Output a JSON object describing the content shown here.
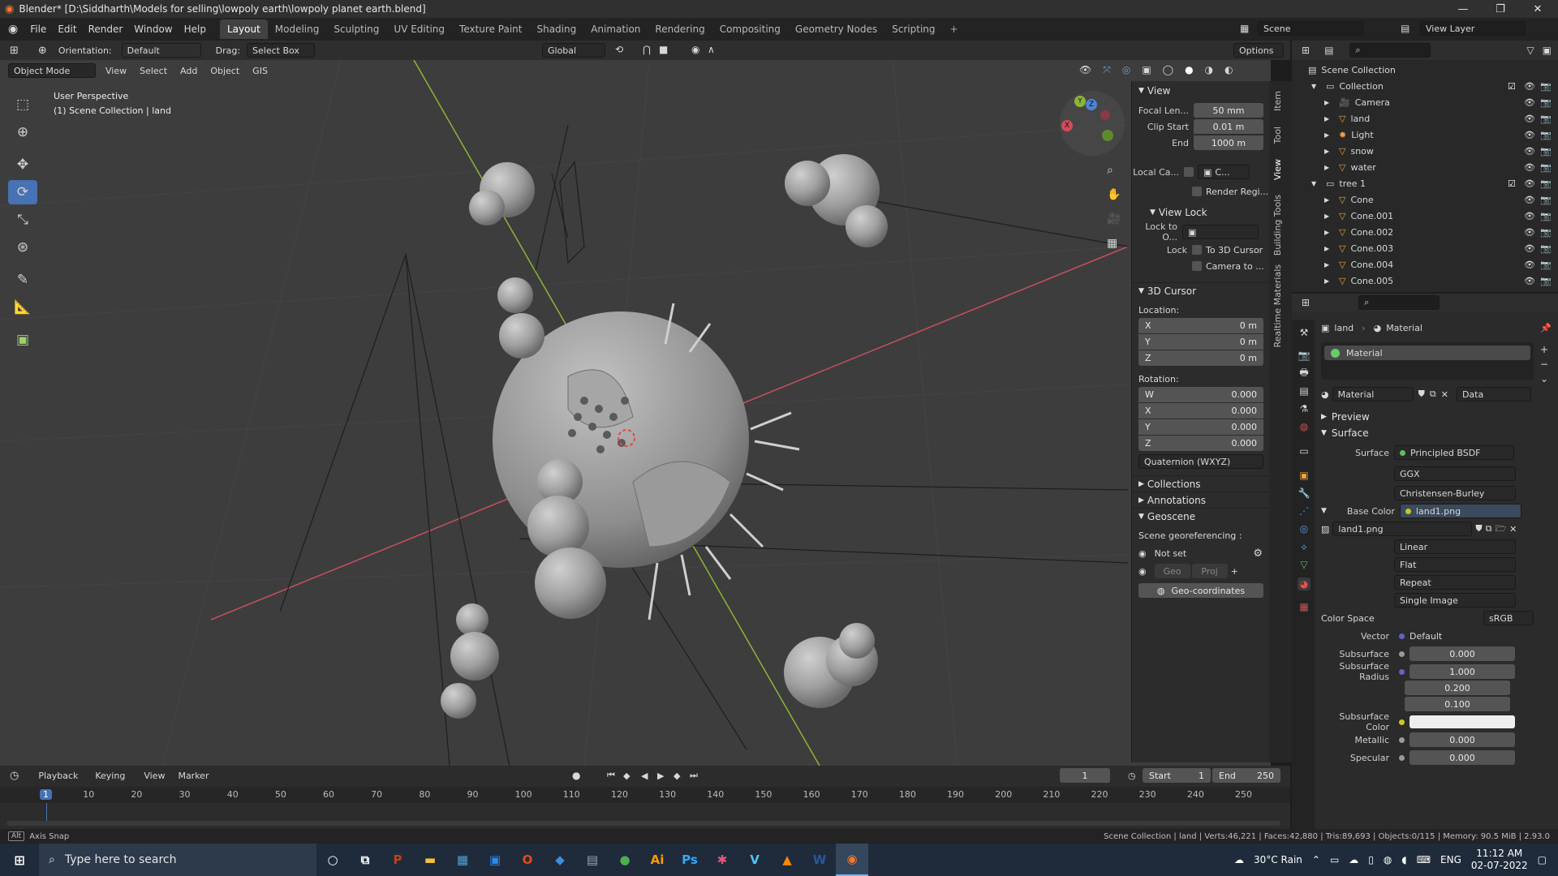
{
  "window": {
    "title": "Blender* [D:\\Siddharth\\Models for selling\\lowpoly earth\\lowpoly planet earth.blend]",
    "controls": [
      "—",
      "❐",
      "✕"
    ]
  },
  "menu": [
    "File",
    "Edit",
    "Render",
    "Window",
    "Help"
  ],
  "workspaces": [
    "Layout",
    "Modeling",
    "Sculpting",
    "UV Editing",
    "Texture Paint",
    "Shading",
    "Animation",
    "Rendering",
    "Compositing",
    "Geometry Nodes",
    "Scripting"
  ],
  "scene": {
    "scene_name": "Scene",
    "view_layer": "View Layer"
  },
  "header": {
    "orientation_label": "Orientation:",
    "orientation": "Default",
    "drag_label": "Drag:",
    "drag": "Select Box",
    "transform": "Global",
    "options": "Options"
  },
  "viewport_menu": {
    "mode": "Object Mode",
    "items": [
      "View",
      "Select",
      "Add",
      "Object",
      "GIS"
    ]
  },
  "viewport": {
    "perspective": "User Perspective",
    "collection": "(1) Scene Collection | land"
  },
  "gizmo": {
    "x": "X",
    "y": "Y",
    "z": "Z"
  },
  "npanel": {
    "view_title": "View",
    "focal_label": "Focal Len...",
    "focal": "50 mm",
    "clip_start_label": "Clip Start",
    "clip_start": "0.01 m",
    "end_label": "End",
    "end": "1000 m",
    "local_cam_label": "Local Ca...",
    "local_cam_value": "C...",
    "render_region": "Render Regi...",
    "view_lock_title": "View Lock",
    "lock_to_label": "Lock to O...",
    "lock_label": "Lock",
    "to_3d_cursor": "To 3D Cursor",
    "camera_to": "Camera to ...",
    "cursor_title": "3D Cursor",
    "location_label": "Location:",
    "loc_x_label": "X",
    "loc_x": "0 m",
    "loc_y_label": "Y",
    "loc_y": "0 m",
    "loc_z_label": "Z",
    "loc_z": "0 m",
    "rotation_label": "Rotation:",
    "rot_w_label": "W",
    "rot_w": "0.000",
    "rot_x_label": "X",
    "rot_x": "0.000",
    "rot_y_label": "Y",
    "rot_y": "0.000",
    "rot_z_label": "Z",
    "rot_z": "0.000",
    "rotation_mode": "Quaternion (WXYZ)",
    "collections": "Collections",
    "annotations": "Annotations",
    "geoscene": "Geoscene",
    "georef_label": "Scene georeferencing :",
    "not_set": "Not set",
    "geo_btn": "Geo",
    "proj_btn": "Proj",
    "geocoords": "Geo-coordinates"
  },
  "side_tabs": [
    "Item",
    "Tool",
    "View",
    "Building Tools",
    "Realtime Materials"
  ],
  "outliner": {
    "root": "Scene Collection",
    "rows": [
      {
        "name": "Collection",
        "level": 1
      },
      {
        "name": "Camera",
        "level": 2
      },
      {
        "name": "land",
        "level": 2
      },
      {
        "name": "Light",
        "level": 2
      },
      {
        "name": "snow",
        "level": 2
      },
      {
        "name": "water",
        "level": 2
      },
      {
        "name": "tree 1",
        "level": 1
      },
      {
        "name": "Cone",
        "level": 2
      },
      {
        "name": "Cone.001",
        "level": 2
      },
      {
        "name": "Cone.002",
        "level": 2
      },
      {
        "name": "Cone.003",
        "level": 2
      },
      {
        "name": "Cone.004",
        "level": 2
      },
      {
        "name": "Cone.005",
        "level": 2
      }
    ]
  },
  "properties": {
    "breadcrumb_object": "land",
    "breadcrumb_material": "Material",
    "slot": "Material",
    "material_name": "Material",
    "link": "Data",
    "preview": "Preview",
    "surface_section": "Surface",
    "surface_label": "Surface",
    "surface_value": "Principled BSDF",
    "distribution": "GGX",
    "subsurface_method": "Christensen-Burley",
    "base_color_label": "Base Color",
    "base_color_value": "land1.png",
    "image_name": "land1.png",
    "interpolation": "Linear",
    "projection": "Flat",
    "extension": "Repeat",
    "source": "Single Image",
    "color_space_label": "Color Space",
    "color_space": "sRGB",
    "vector_label": "Vector",
    "vector": "Default",
    "subsurface_label": "Subsurface",
    "subsurface": "0.000",
    "subsurface_radius_label": "Subsurface Radius",
    "radius": [
      "1.000",
      "0.200",
      "0.100"
    ],
    "subsurface_color_label": "Subsurface Color",
    "metallic_label": "Metallic",
    "metallic": "0.000",
    "specular_label": "Specular",
    "specular": "0.000"
  },
  "timeline": {
    "menus": [
      "Playback",
      "Keying",
      "View",
      "Marker"
    ],
    "current_frame": "1",
    "start_label": "Start",
    "start": "1",
    "end_label": "End",
    "end": "250",
    "ticks": [
      "1",
      "10",
      "20",
      "30",
      "40",
      "50",
      "60",
      "70",
      "80",
      "90",
      "100",
      "110",
      "120",
      "130",
      "140",
      "150",
      "160",
      "170",
      "180",
      "190",
      "200",
      "210",
      "220",
      "230",
      "240",
      "250"
    ]
  },
  "status": {
    "left": "Axis Snap",
    "right": "Scene Collection | land | Verts:46,221 | Faces:42,880 | Tris:89,693 | Objects:0/115 | Memory: 90.5 MiB | 2.93.0"
  },
  "taskbar": {
    "search_placeholder": "Type here to search",
    "apps": [
      {
        "name": "powerpoint",
        "glyph": "P",
        "color": "#c43e1c"
      },
      {
        "name": "file-explorer",
        "glyph": "▬",
        "color": "#f3c13a"
      },
      {
        "name": "photos",
        "glyph": "▦",
        "color": "#4aa3df"
      },
      {
        "name": "store",
        "glyph": "▣",
        "color": "#2d89ef"
      },
      {
        "name": "office",
        "glyph": "O",
        "color": "#e64a19"
      },
      {
        "name": "app-blue",
        "glyph": "◆",
        "color": "#3f8de0"
      },
      {
        "name": "app-gray",
        "glyph": "▤",
        "color": "#9aa4b0"
      },
      {
        "name": "chrome",
        "glyph": "●",
        "color": "#4caf50"
      },
      {
        "name": "illustrator",
        "glyph": "Ai",
        "color": "#ff9a00"
      },
      {
        "name": "photoshop",
        "glyph": "Ps",
        "color": "#31a8ff"
      },
      {
        "name": "app-colorful",
        "glyph": "✱",
        "color": "#e05a7a"
      },
      {
        "name": "vscode-like",
        "glyph": "V",
        "color": "#4fc3f7"
      },
      {
        "name": "vlc",
        "glyph": "▲",
        "color": "#ff8800"
      },
      {
        "name": "word",
        "glyph": "W",
        "color": "#2b579a"
      },
      {
        "name": "blender",
        "glyph": "◉",
        "color": "#f5792a"
      }
    ],
    "weather": "30°C  Rain",
    "lang": "ENG",
    "time": "11:12 AM",
    "date": "02-07-2022"
  }
}
